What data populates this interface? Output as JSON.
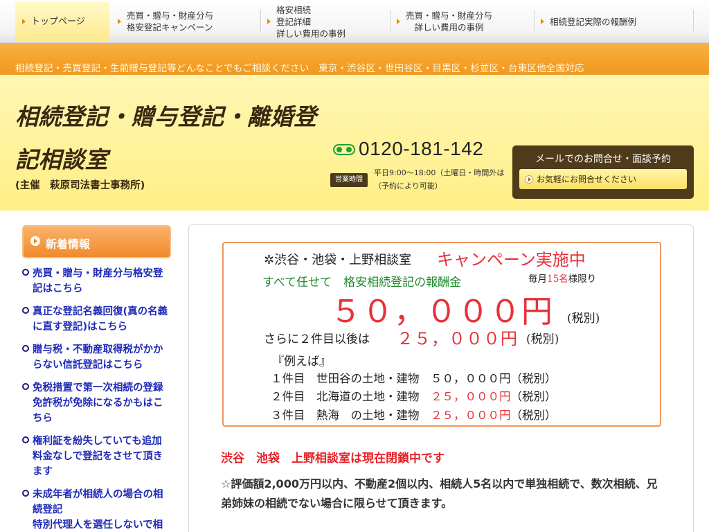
{
  "nav": {
    "items": [
      {
        "label": "トップページ"
      },
      {
        "line1": "売買・贈与・財産分与",
        "line2": "格安登記キャンペーン"
      },
      {
        "line1": "格安相続",
        "line2": "登記詳細",
        "line3": "詳しい費用の事例"
      },
      {
        "line1": "売買・贈与・財産分与",
        "line2": "詳しい費用の事例"
      },
      {
        "label": "相続登記実際の報酬例"
      }
    ]
  },
  "strip": {
    "text": "相続登記・売買登記・生前贈与登記等どんなことでもご相談ください　東京・渋谷区・世田谷区・目黒区・杉並区・台東区他全国対応"
  },
  "header": {
    "title": "相続登記・贈与登記・離婚登記相談室",
    "subtitle": "(主催　萩原司法書士事務所)",
    "tel": "0120-181-142",
    "hours_badge": "営業時間",
    "hours_line1": "平日9:00〜18:00（土曜日・時間外は",
    "hours_line2": "（予約により可能）",
    "mail_title": "メールでのお問合せ・面談予約",
    "mail_button": "お気軽にお問合せください"
  },
  "sidebar": {
    "heading": "新着情報",
    "items": [
      "売買・贈与・財産分与格安登記はこちら",
      "真正な登記名義回復(真の名義に直す登記)はこちら",
      "贈与税・不動産取得税がかからない信託登記はこちら",
      "免税措置で第一次相続の登録免許税が免除になるかもはこちら",
      "権利証を紛失していても追加料金なしで登記をさせて頂きます",
      "未成年者が相続人の場合の相続登記\n特別代理人を選任しないで相"
    ]
  },
  "campaign": {
    "line1": "✲渋谷・池袋・上野相談室",
    "line1_red": "キャンペーン実施中",
    "line2": "すべて任せて　格安相続登記の報酬金",
    "limit_pre": "毎月",
    "limit_num": "15名",
    "limit_post": "様限り",
    "price": "５０，０００円",
    "price_tax": "(税別)",
    "line4": "さらに２件目以後は",
    "line4_red": "２５，０００円",
    "line4_tax": "(税別)",
    "example": "『例えば』",
    "rows": [
      {
        "text": "１件目　世田谷の土地・建物　",
        "price": "５０，０００円",
        "tax": "（税別）",
        "red": false
      },
      {
        "text": "２件目　北海道の土地・建物　",
        "price": "２５，０００円",
        "tax": "（税別）",
        "red": true
      },
      {
        "text": "３件目　熱海　の土地・建物　",
        "price": "２５，０００円",
        "tax": "（税別）",
        "red": true
      }
    ]
  },
  "main": {
    "closed_notice": "渋谷　池袋　上野相談室は現在閉鎖中です",
    "notes": "☆評価額2,000万円以内、不動産2個以内、相続人5名以内で単独相続で、数次相続、兄弟姉妹の相続でない場合に限らせて頂きます。"
  },
  "colors": {
    "accent_orange": "#f5a02a",
    "header_yellow": "#fff2a0",
    "campaign_red": "#e8303a",
    "link_blue": "#1f2bb8"
  }
}
